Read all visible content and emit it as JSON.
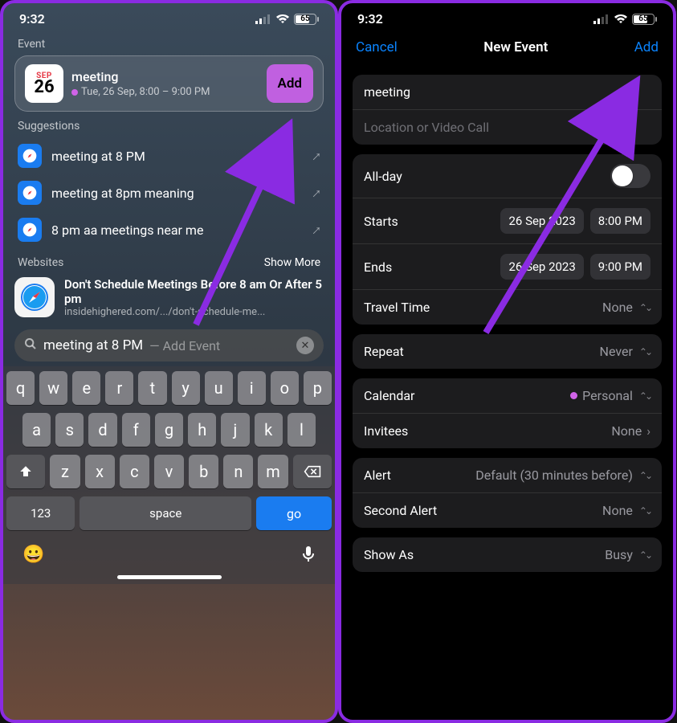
{
  "status": {
    "time": "9:32",
    "battery": "65"
  },
  "left": {
    "sections": {
      "event": "Event",
      "suggestions": "Suggestions",
      "websites": "Websites",
      "show_more": "Show More"
    },
    "event": {
      "month": "SEP",
      "day": "26",
      "title": "meeting",
      "subtitle": "Tue, 26 Sep, 8:00 – 9:00 PM",
      "add": "Add"
    },
    "suggestions": [
      "meeting at 8 PM",
      "meeting at 8pm meaning",
      "8 pm aa meetings near me"
    ],
    "website": {
      "title": "Don't Schedule Meetings Before 8 am Or After 5 pm",
      "url": "insidehighered.com/.../don't-schedule-me..."
    },
    "search": {
      "text": "meeting at 8 PM",
      "hint": "— Add Event"
    },
    "keyboard": {
      "row1": [
        "q",
        "w",
        "e",
        "r",
        "t",
        "y",
        "u",
        "i",
        "o",
        "p"
      ],
      "row2": [
        "a",
        "s",
        "d",
        "f",
        "g",
        "h",
        "j",
        "k",
        "l"
      ],
      "row3_mid": [
        "z",
        "x",
        "c",
        "v",
        "b",
        "n",
        "m"
      ],
      "num": "123",
      "space": "space",
      "go": "go"
    }
  },
  "right": {
    "nav": {
      "cancel": "Cancel",
      "title": "New Event",
      "add": "Add"
    },
    "title_field": "meeting",
    "location_placeholder": "Location or Video Call",
    "allday": "All-day",
    "starts": {
      "label": "Starts",
      "date": "26 Sep 2023",
      "time": "8:00 PM"
    },
    "ends": {
      "label": "Ends",
      "date": "26 Sep 2023",
      "time": "9:00 PM"
    },
    "travel": {
      "label": "Travel Time",
      "value": "None"
    },
    "repeat": {
      "label": "Repeat",
      "value": "Never"
    },
    "calendar": {
      "label": "Calendar",
      "value": "Personal"
    },
    "invitees": {
      "label": "Invitees",
      "value": "None"
    },
    "alert": {
      "label": "Alert",
      "value": "Default (30 minutes before)"
    },
    "second_alert": {
      "label": "Second Alert",
      "value": "None"
    },
    "show_as": {
      "label": "Show As",
      "value": "Busy"
    }
  }
}
